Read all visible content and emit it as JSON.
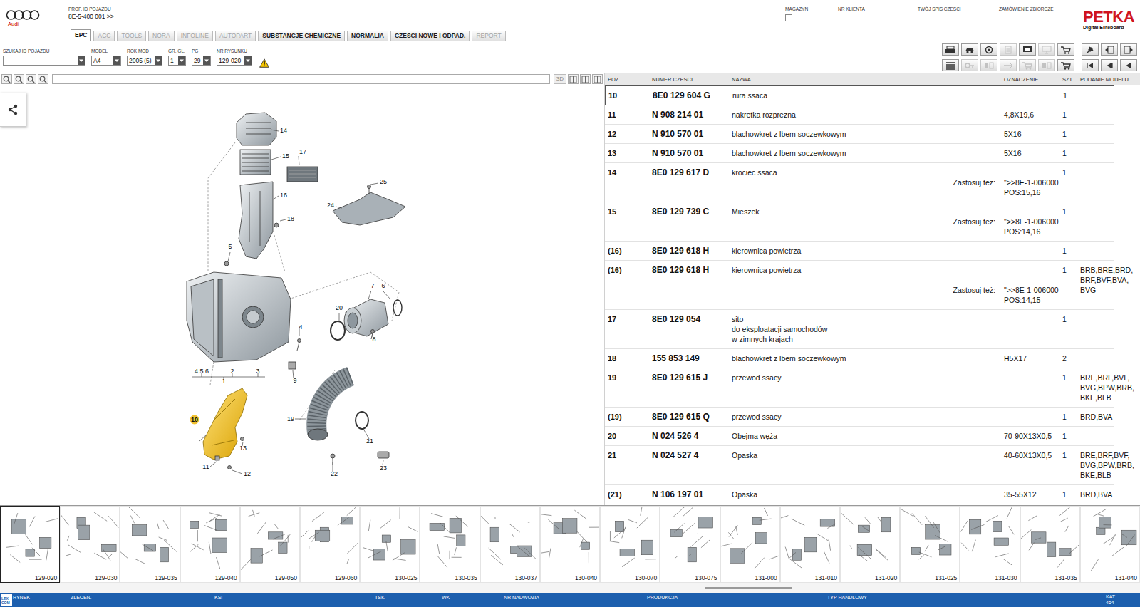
{
  "header": {
    "brand": "Audi",
    "vehicle_id_label": "PROF. ID POJAZDU",
    "vehicle_id": "8E-5-400 001 >>",
    "magazyn": {
      "label": "MAGAZYN",
      "checked": false
    },
    "fields": [
      "NR KLIENTA",
      "TWÓJ SPIS CZESCI",
      "ZAMÓWIENIE ZBIORCZE"
    ],
    "logo": {
      "name": "PETKA",
      "subtitle": "Digital Eliteboard"
    }
  },
  "tabs": [
    {
      "label": "EPC",
      "selected": true,
      "disabled": false
    },
    {
      "label": "ACC",
      "selected": false,
      "disabled": true
    },
    {
      "label": "TOOLS",
      "selected": false,
      "disabled": true
    },
    {
      "label": "NORA",
      "selected": false,
      "disabled": true
    },
    {
      "label": "INFOLINE",
      "selected": false,
      "disabled": true
    },
    {
      "label": "AUTOPART",
      "selected": false,
      "disabled": true
    },
    {
      "label": "SUBSTANCJE CHEMICZNE",
      "selected": false,
      "disabled": false
    },
    {
      "label": "NORMALIA",
      "selected": false,
      "disabled": false
    },
    {
      "label": "CZESCI NOWE I ODPAD.",
      "selected": false,
      "disabled": false
    },
    {
      "label": "REPORT",
      "selected": false,
      "disabled": true
    }
  ],
  "filters": [
    {
      "label": "SZUKAJ ID POJAZDU",
      "value": ""
    },
    {
      "label": "MODEL",
      "value": "A4"
    },
    {
      "label": "ROK MOD",
      "value": "2005 (5)"
    },
    {
      "label": "GR. GL.",
      "value": "1"
    },
    {
      "label": "PG",
      "value": "29"
    },
    {
      "label": "NR RYSUNKU",
      "value": "129-020"
    }
  ],
  "toolbar": [
    {
      "disabled": false
    },
    {
      "disabled": false
    },
    {
      "disabled": false
    },
    {
      "disabled": true
    },
    {
      "disabled": false
    },
    {
      "disabled": true
    },
    {
      "disabled": false
    },
    {
      "disabled": false
    },
    {
      "disabled": true
    },
    {
      "disabled": true
    },
    {
      "disabled": true
    },
    {
      "disabled": true
    },
    {
      "disabled": true
    },
    {
      "disabled": false
    }
  ],
  "nav": [
    {
      "disabled": false
    },
    {
      "disabled": false
    },
    {
      "disabled": false
    },
    {
      "disabled": false
    },
    {
      "disabled": false
    },
    {
      "disabled": false
    }
  ],
  "diagram": {
    "view_button": "3D",
    "callouts": [
      {
        "label": "14",
        "selected": false
      },
      {
        "label": "15",
        "selected": false
      },
      {
        "label": "17",
        "selected": false
      },
      {
        "label": "16",
        "selected": false
      },
      {
        "label": "25",
        "selected": false
      },
      {
        "label": "24",
        "selected": false
      },
      {
        "label": "18",
        "selected": false
      },
      {
        "label": "5",
        "selected": false
      },
      {
        "label": "7",
        "selected": false
      },
      {
        "label": "6",
        "selected": false
      },
      {
        "label": "20",
        "selected": false
      },
      {
        "label": "4",
        "selected": false
      },
      {
        "label": "8",
        "selected": false
      },
      {
        "label": "9",
        "selected": false
      },
      {
        "label": "4.5.6",
        "selected": false
      },
      {
        "label": "2",
        "selected": false
      },
      {
        "label": "3",
        "selected": false
      },
      {
        "label": "1",
        "selected": false
      },
      {
        "label": "10",
        "selected": true
      },
      {
        "label": "13",
        "selected": false
      },
      {
        "label": "11",
        "selected": false
      },
      {
        "label": "12",
        "selected": false
      },
      {
        "label": "19",
        "selected": false
      },
      {
        "label": "21",
        "selected": false
      },
      {
        "label": "22",
        "selected": false
      },
      {
        "label": "23",
        "selected": false
      }
    ]
  },
  "table": {
    "columns": [
      "POZ.",
      "NUMER CZESCI",
      "NAZWA",
      "OZNACZENIE",
      "SZT.",
      "PODANIE MODELU"
    ],
    "rows": [
      {
        "pos": "10",
        "number": "8E0 129 604 G",
        "name": [
          "rura ssaca"
        ],
        "designation": "",
        "qty": "1",
        "models": [],
        "note": null,
        "selected": true
      },
      {
        "pos": "11",
        "number": "N  908 214 01",
        "name": [
          "nakretka rozprezna"
        ],
        "designation": "4,8X19,6",
        "qty": "1",
        "models": [],
        "note": null,
        "selected": false
      },
      {
        "pos": "12",
        "number": "N  910 570 01",
        "name": [
          "blachowkret z lbem soczewkowym"
        ],
        "designation": "5X16",
        "qty": "1",
        "models": [],
        "note": null,
        "selected": false
      },
      {
        "pos": "13",
        "number": "N  910 570 01",
        "name": [
          "blachowkret z lbem soczewkowym"
        ],
        "designation": "5X16",
        "qty": "1",
        "models": [],
        "note": null,
        "selected": false
      },
      {
        "pos": "14",
        "number": "8E0 129 617 D",
        "name": [
          "krociec ssaca"
        ],
        "designation": "",
        "qty": "1",
        "models": [],
        "note": {
          "label": "Zastosuj też:",
          "value": [
            "\">>8E-1-006000",
            "POS:15,16"
          ]
        },
        "selected": false
      },
      {
        "pos": "15",
        "number": "8E0 129 739 C",
        "name": [
          "Mieszek"
        ],
        "designation": "",
        "qty": "1",
        "models": [],
        "note": {
          "label": "Zastosuj też:",
          "value": [
            "\">>8E-1-006000",
            "POS:14,16"
          ]
        },
        "selected": false
      },
      {
        "pos": "(16)",
        "number": "8E0 129 618 H",
        "name": [
          "kierownica powietrza"
        ],
        "designation": "",
        "qty": "1",
        "models": [],
        "note": null,
        "selected": false
      },
      {
        "pos": "(16)",
        "number": "8E0 129 618 H",
        "name": [
          "kierownica powietrza"
        ],
        "designation": "",
        "qty": "1",
        "models": [
          "BRB,BRE,BRD,",
          "BRF,BVF,BVA,",
          "BVG"
        ],
        "note": {
          "label": "Zastosuj też:",
          "value": [
            "\">>8E-1-006000",
            "POS:14,15"
          ]
        },
        "selected": false
      },
      {
        "pos": "17",
        "number": "8E0 129 054",
        "name": [
          "sito",
          "do eksploatacji samochodów",
          "w zimnych krajach"
        ],
        "designation": "",
        "qty": "1",
        "models": [],
        "note": null,
        "selected": false
      },
      {
        "pos": "18",
        "number": "155 853 149",
        "name": [
          "blachowkret z lbem soczewkowym"
        ],
        "designation": "H5X17",
        "qty": "2",
        "models": [],
        "note": null,
        "selected": false
      },
      {
        "pos": "19",
        "number": "8E0 129 615 J",
        "name": [
          "przewod ssacy"
        ],
        "designation": "",
        "qty": "1",
        "models": [
          "BRE,BRF,BVF,",
          "BVG,BPW,BRB,",
          "BKE,BLB"
        ],
        "note": null,
        "selected": false
      },
      {
        "pos": "(19)",
        "number": "8E0 129 615 Q",
        "name": [
          "przewod ssacy"
        ],
        "designation": "",
        "qty": "1",
        "models": [
          "BRD,BVA"
        ],
        "note": null,
        "selected": false
      },
      {
        "pos": "20",
        "number": "N  024 526 4",
        "name": [
          "Obejma węża"
        ],
        "designation": "70-90X13X0,5",
        "qty": "1",
        "models": [],
        "note": null,
        "selected": false
      },
      {
        "pos": "21",
        "number": "N  024 527 4",
        "name": [
          "Opaska"
        ],
        "designation": "40-60X13X0,5",
        "qty": "1",
        "models": [
          "BRE,BRF,BVF,",
          "BVG,BPW,BRB,",
          "BKE,BLB"
        ],
        "note": null,
        "selected": false
      },
      {
        "pos": "(21)",
        "number": "N  106 197 01",
        "name": [
          "Opaska"
        ],
        "designation": "35-55X12",
        "qty": "1",
        "models": [
          "BRD,BVA"
        ],
        "note": null,
        "selected": false
      }
    ]
  },
  "thumbnails": [
    {
      "label": "129-020",
      "selected": true
    },
    {
      "label": "129-030",
      "selected": false
    },
    {
      "label": "129-035",
      "selected": false
    },
    {
      "label": "129-040",
      "selected": false
    },
    {
      "label": "129-050",
      "selected": false
    },
    {
      "label": "129-060",
      "selected": false
    },
    {
      "label": "130-025",
      "selected": false
    },
    {
      "label": "130-035",
      "selected": false
    },
    {
      "label": "130-037",
      "selected": false
    },
    {
      "label": "130-040",
      "selected": false
    },
    {
      "label": "130-070",
      "selected": false
    },
    {
      "label": "130-075",
      "selected": false
    },
    {
      "label": "131-000",
      "selected": false
    },
    {
      "label": "131-010",
      "selected": false
    },
    {
      "label": "131-020",
      "selected": false
    },
    {
      "label": "131-025",
      "selected": false
    },
    {
      "label": "131-030",
      "selected": false
    },
    {
      "label": "131-035",
      "selected": false
    },
    {
      "label": "131-040",
      "selected": false
    }
  ],
  "status_bar": {
    "logo": [
      "LEX",
      "COM"
    ],
    "fields": [
      "RYNEK",
      "ZLECEN.",
      "KSI",
      "TSK",
      "WK",
      "NR NADWOZIA",
      "PRODUKCJA",
      "TYP HANDLOWY"
    ],
    "catalog": {
      "label": "KAT",
      "value": "454"
    }
  }
}
